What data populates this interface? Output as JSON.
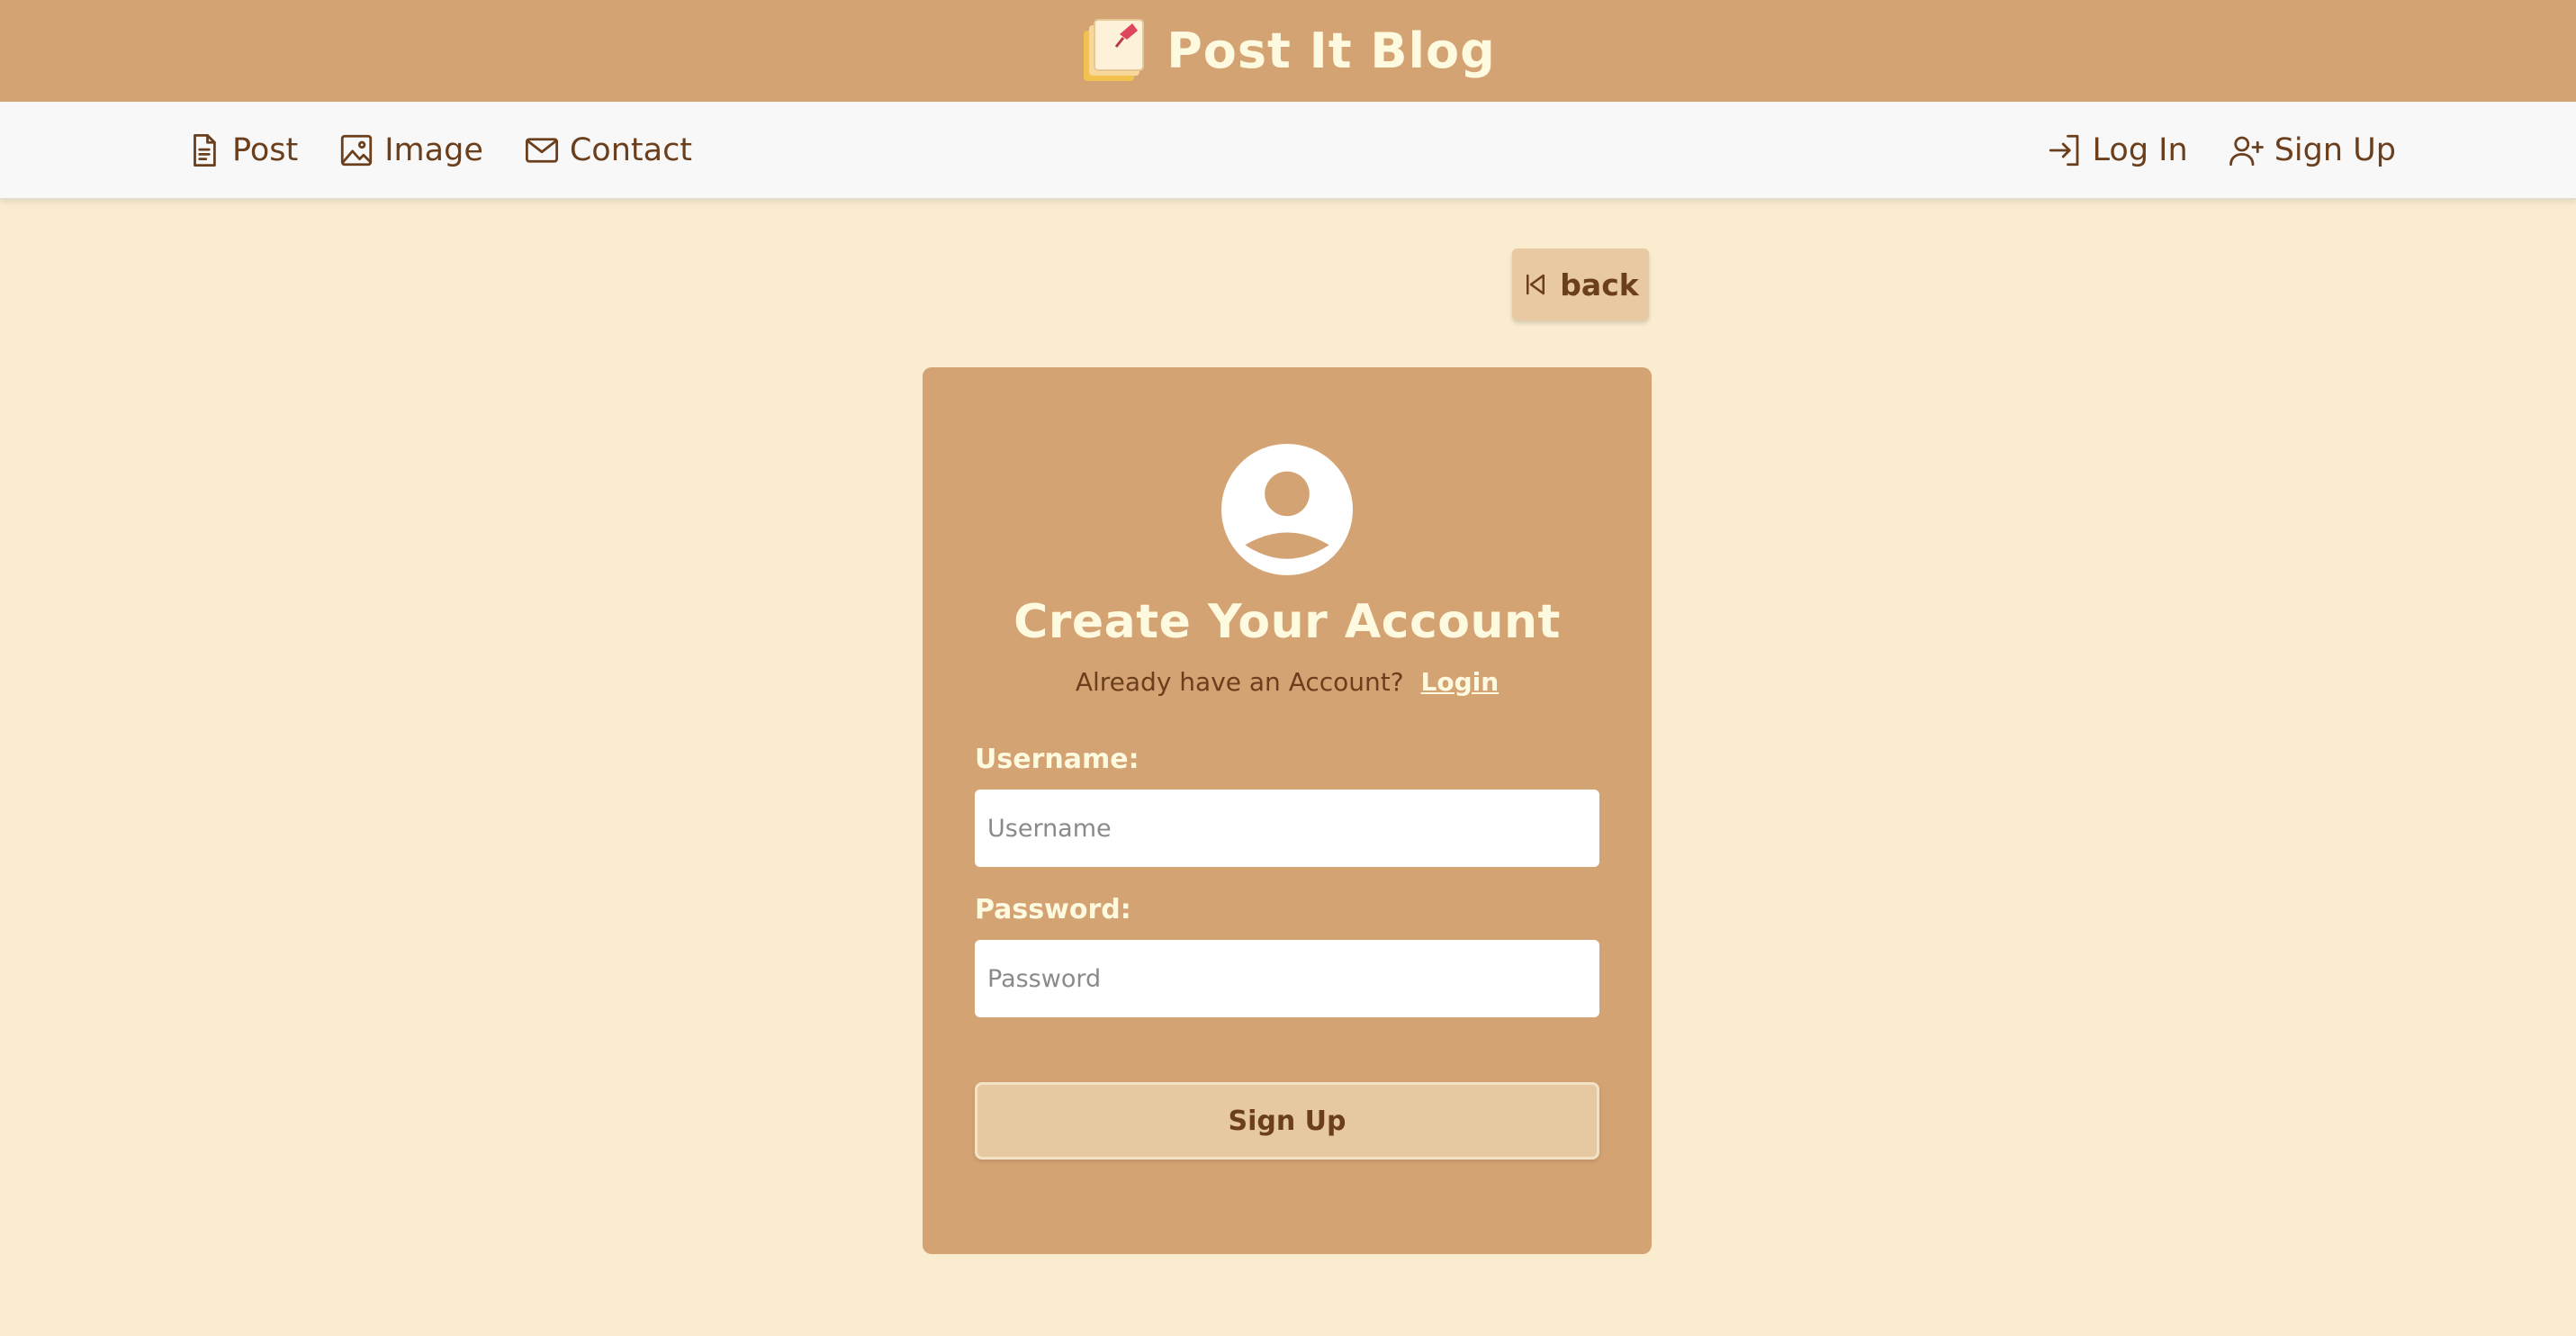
{
  "brand": {
    "title": "Post It Blog",
    "logo_icon": "sticky-note-logo-icon"
  },
  "nav": {
    "left": [
      {
        "label": "Post",
        "icon": "document-icon"
      },
      {
        "label": "Image",
        "icon": "image-icon"
      },
      {
        "label": "Contact",
        "icon": "envelope-icon"
      }
    ],
    "right": [
      {
        "label": "Log In",
        "icon": "login-icon"
      },
      {
        "label": "Sign Up",
        "icon": "person-add-icon"
      }
    ]
  },
  "back": {
    "label": "back",
    "icon": "skip-back-icon"
  },
  "form": {
    "avatar_icon": "user-avatar-icon",
    "title": "Create Your Account",
    "subtitle": "Already have an Account?",
    "login_link": "Login",
    "username_label": "Username:",
    "username_placeholder": "Username",
    "username_value": "",
    "password_label": "Password:",
    "password_placeholder": "Password",
    "password_value": "",
    "submit_label": "Sign Up"
  },
  "colors": {
    "page_bg": "#faecce",
    "primary": "#d4a373",
    "text_brown": "#6b3e1c",
    "cream": "#fefae0",
    "button": "#e6c9a1",
    "navbar_bg": "#f8f8f8"
  }
}
